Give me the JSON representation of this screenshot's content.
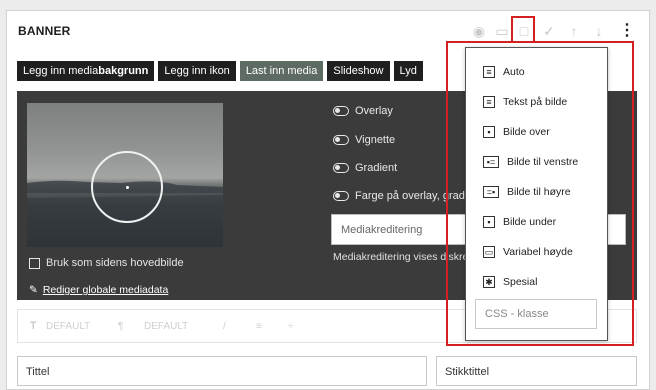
{
  "title": "BANNER",
  "tabs": [
    {
      "prefix": "Legg inn media",
      "bold": "bakgrunn"
    },
    {
      "label": "Legg inn ikon"
    },
    {
      "label": "Last inn media"
    },
    {
      "label": "Slideshow"
    },
    {
      "label": "Lyd"
    }
  ],
  "active_tab_index": 2,
  "toggles": [
    "Overlay",
    "Vignette",
    "Gradient",
    "Farge på overlay, gradient"
  ],
  "checkbox_label": "Bruk som sidens hovedbilde",
  "edit_link": "Rediger globale mediadata",
  "mediakreditering_placeholder": "Mediakreditering",
  "mediakreditering_note": "Mediakreditering vises diskret",
  "toolbar": {
    "default1": "DEFAULT",
    "default2": "DEFAULT"
  },
  "fields": {
    "tittel_placeholder": "Tittel",
    "stikktittel_placeholder": "Stikktittel"
  },
  "dropdown": {
    "items": [
      "Auto",
      "Tekst på bilde",
      "Bilde over",
      "Bilde til venstre",
      "Bilde til høyre",
      "Bilde under",
      "Variabel høyde",
      "Spesial"
    ],
    "css_placeholder": "CSS - klasse"
  },
  "colors": {
    "highlight": "#d42020",
    "tab_bg": "#1f1f1f",
    "tab_active": "#5d6b63",
    "panel": "#3b3b3b"
  }
}
